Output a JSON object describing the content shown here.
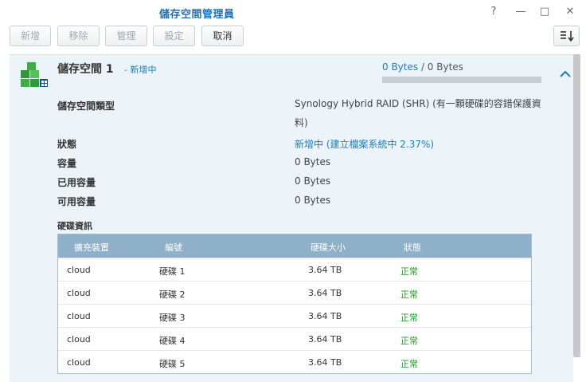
{
  "window": {
    "title": "儲存空間管理員",
    "controls": {
      "help": "?",
      "minimize": "—",
      "maximize": "□",
      "close": "✕"
    }
  },
  "toolbar": {
    "buttons": [
      {
        "label": "新增",
        "enabled": false
      },
      {
        "label": "移除",
        "enabled": false
      },
      {
        "label": "管理",
        "enabled": false
      },
      {
        "label": "設定",
        "enabled": false
      },
      {
        "label": "取消",
        "enabled": true
      }
    ]
  },
  "volume": {
    "name": "儲存空間 1",
    "status": "- 新增中",
    "usage": {
      "used": "0 Bytes",
      "separator": " / ",
      "total": "0 Bytes",
      "fraction": 0
    },
    "details": [
      {
        "label": "儲存空間類型",
        "value": "Synology Hybrid RAID (SHR) (有一顆硬碟的容錯保護資料)",
        "highlight": false
      },
      {
        "label": "狀態",
        "value": "新增中 (建立檔案系統中 2.37%)",
        "highlight": true
      },
      {
        "label": "容量",
        "value": "0 Bytes",
        "highlight": false
      },
      {
        "label": "已用容量",
        "value": "0 Bytes",
        "highlight": false
      },
      {
        "label": "可用容量",
        "value": "0 Bytes",
        "highlight": false
      }
    ]
  },
  "disk_info": {
    "title": "硬碟資訊",
    "columns": [
      "擴充裝置",
      "編號",
      "硬碟大小",
      "狀態"
    ],
    "rows": [
      {
        "device": "cloud",
        "disk": "硬碟 1",
        "size": "3.64 TB",
        "status": "正常"
      },
      {
        "device": "cloud",
        "disk": "硬碟 2",
        "size": "3.64 TB",
        "status": "正常"
      },
      {
        "device": "cloud",
        "disk": "硬碟 3",
        "size": "3.64 TB",
        "status": "正常"
      },
      {
        "device": "cloud",
        "disk": "硬碟 4",
        "size": "3.64 TB",
        "status": "正常"
      },
      {
        "device": "cloud",
        "disk": "硬碟 5",
        "size": "3.64 TB",
        "status": "正常"
      }
    ]
  },
  "colors": {
    "accent": "#1a7fc1",
    "ok": "#1e9c1e",
    "header": "#8fb0c9",
    "panel": "#ecf4fa"
  }
}
